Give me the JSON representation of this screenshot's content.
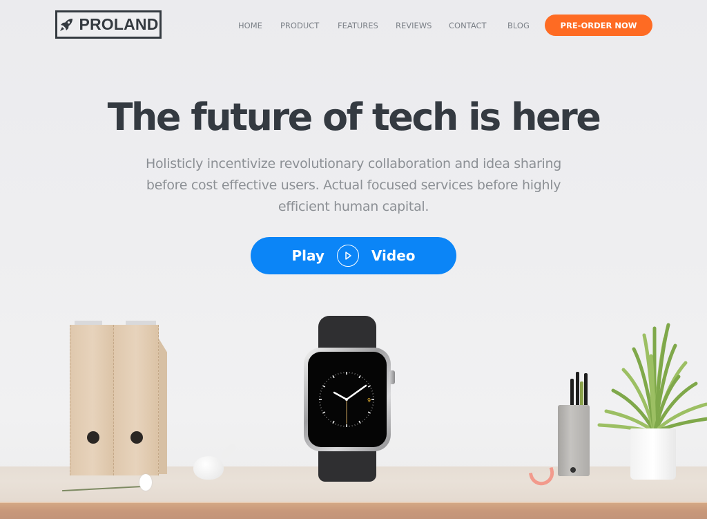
{
  "header": {
    "logo_text": "PROLAND",
    "logo_icon": "rocket-icon",
    "nav": [
      {
        "label": "HOME"
      },
      {
        "label": "PRODUCT"
      },
      {
        "label": "FEATURES"
      },
      {
        "label": "REVIEWS"
      },
      {
        "label": "CONTACT"
      },
      {
        "label": "BLOG"
      }
    ],
    "cta_label": "PRE-ORDER NOW"
  },
  "hero": {
    "title": "The future of tech is here",
    "subtitle": "Holisticly incentivize revolutionary collaboration and idea sharing before cost effective users. Actual focused services before highly efficient human capital.",
    "play_button": {
      "label_left": "Play",
      "icon": "play-circle-icon",
      "label_right": "Video"
    }
  },
  "product": {
    "watch_date": "9"
  },
  "colors": {
    "accent_orange": "#fe6b23",
    "accent_blue": "#0b85f7",
    "heading": "#343a41",
    "body_text": "#8c9095",
    "nav_text": "#7c8188"
  }
}
